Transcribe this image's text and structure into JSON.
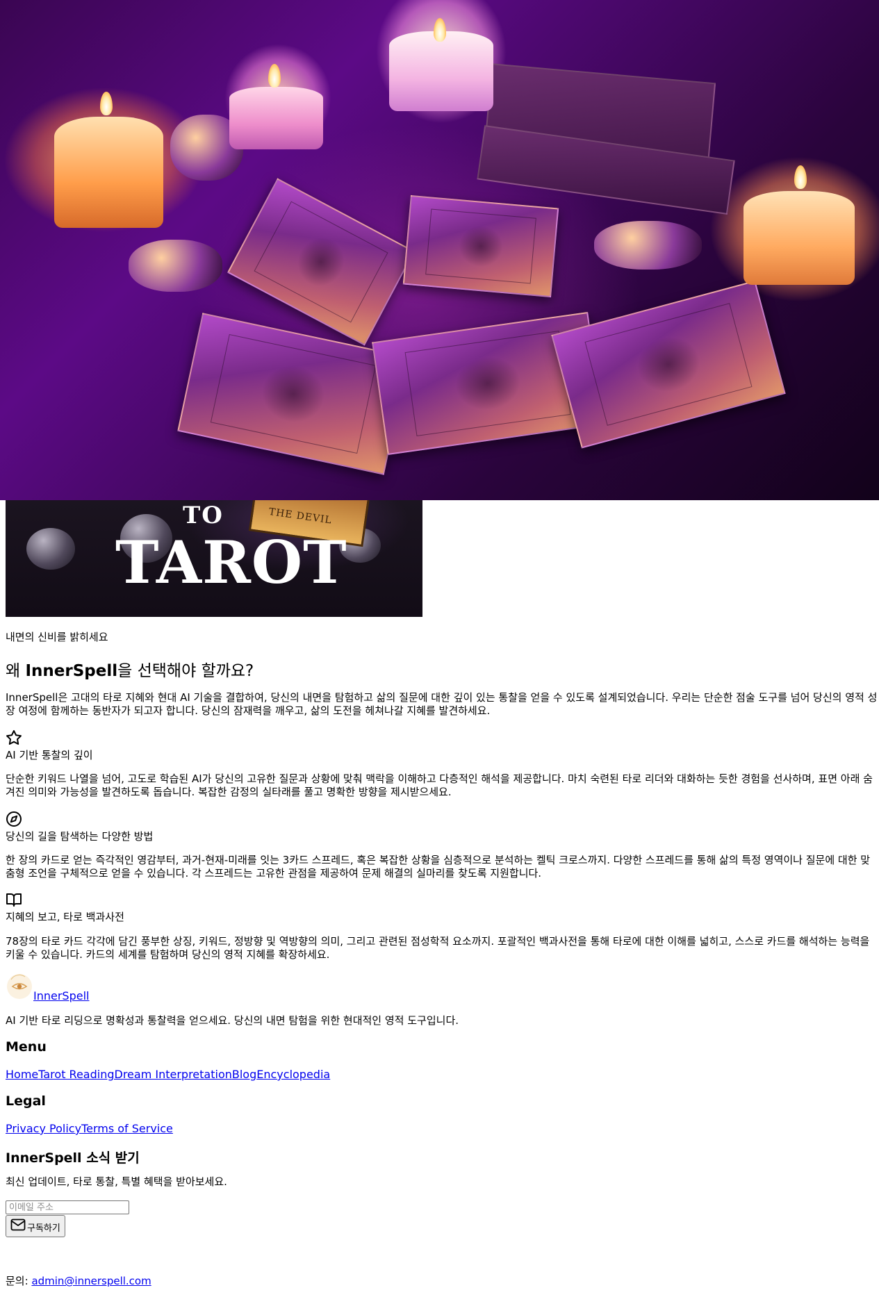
{
  "hero": {
    "image": "tarot-cards-candles-photo"
  },
  "banner": {
    "line1": "TO",
    "line2": "TAROT",
    "card_label": "THE DEVIL"
  },
  "tagline": "내면의 신비를 밝히세요",
  "why": {
    "title_prefix": "왜 ",
    "title_brand": "InnerSpell",
    "title_suffix": "을 선택해야 할까요?",
    "intro": "InnerSpell은 고대의 타로 지혜와 현대 AI 기술을 결합하여, 당신의 내면을 탐험하고 삶의 질문에 대한 깊이 있는 통찰을 얻을 수 있도록 설계되었습니다. 우리는 단순한 점술 도구를 넘어 당신의 영적 성장 여정에 함께하는 동반자가 되고자 합니다. 당신의 잠재력을 깨우고, 삶의 도전을 헤쳐나갈 지혜를 발견하세요."
  },
  "features": [
    {
      "icon": "star-icon",
      "title": "AI 기반 통찰의 깊이",
      "desc": "단순한 키워드 나열을 넘어, 고도로 학습된 AI가 당신의 고유한 질문과 상황에 맞춰 맥락을 이해하고 다층적인 해석을 제공합니다. 마치 숙련된 타로 리더와 대화하는 듯한 경험을 선사하며, 표면 아래 숨겨진 의미와 가능성을 발견하도록 돕습니다. 복잡한 감정의 실타래를 풀고 명확한 방향을 제시받으세요."
    },
    {
      "icon": "compass-icon",
      "title": "당신의 길을 탐색하는 다양한 방법",
      "desc": "한 장의 카드로 얻는 즉각적인 영감부터, 과거-현재-미래를 잇는 3카드 스프레드, 혹은 복잡한 상황을 심층적으로 분석하는 켈틱 크로스까지. 다양한 스프레드를 통해 삶의 특정 영역이나 질문에 대한 맞춤형 조언을 구체적으로 얻을 수 있습니다. 각 스프레드는 고유한 관점을 제공하여 문제 해결의 실마리를 찾도록 지원합니다."
    },
    {
      "icon": "book-icon",
      "title": "지혜의 보고, 타로 백과사전",
      "desc": "78장의 타로 카드 각각에 담긴 풍부한 상징, 키워드, 정방향 및 역방향의 의미, 그리고 관련된 점성학적 요소까지. 포괄적인 백과사전을 통해 타로에 대한 이해를 넓히고, 스스로 카드를 해석하는 능력을 키울 수 있습니다. 카드의 세계를 탐험하며 당신의 영적 지혜를 확장하세요."
    }
  ],
  "footer": {
    "brand": "InnerSpell",
    "description": "AI 기반 타로 리딩으로 명확성과 통찰력을 얻으세요. 당신의 내면 탐험을 위한 현대적인 영적 도구입니다.",
    "menu_title": "Menu",
    "menu": [
      "Home",
      "Tarot Reading",
      "Dream Interpretation",
      "Blog",
      "Encyclopedia"
    ],
    "legal_title": "Legal",
    "legal": [
      "Privacy Policy",
      "Terms of Service"
    ],
    "newsletter_title": "InnerSpell 소식 받기",
    "newsletter_desc": "최신 업데이트, 타로 통찰, 특별 혜택을 받아보세요.",
    "email_placeholder": "이메일 주소",
    "subscribe_label": "구독하기",
    "contact_label": "문의: ",
    "contact_email": "admin@innerspell.com"
  }
}
